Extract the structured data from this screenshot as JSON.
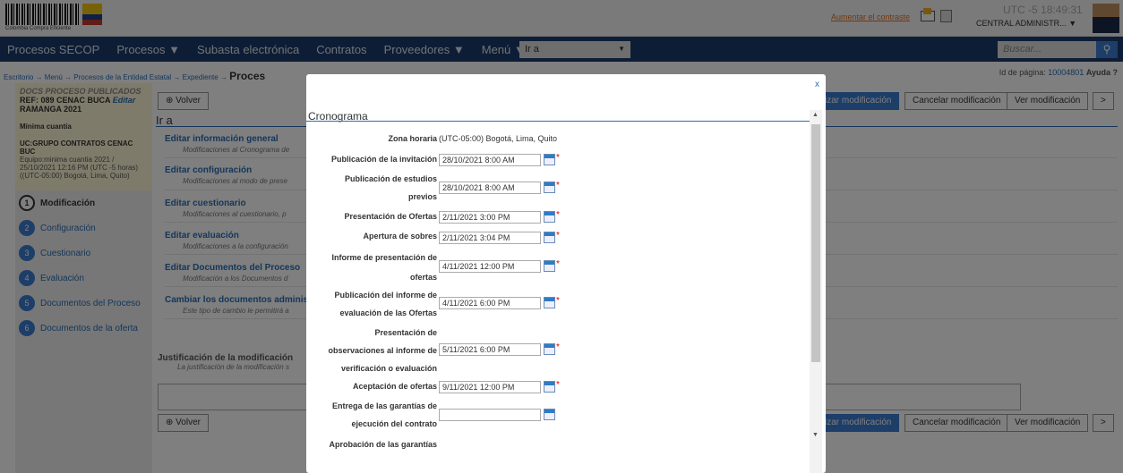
{
  "header": {
    "logo_caption": "Colombia Compra Eficiente",
    "toplink": "Aumentar el contraste",
    "clock_zone": "UTC -5",
    "clock_time": "18:49:31",
    "user": "CENTRAL ADMINISTR..."
  },
  "nav": {
    "items": [
      "Procesos SECOP",
      "Procesos ▼",
      "Subasta electrónica",
      "Contratos",
      "Proveedores ▼",
      "Menú ▼"
    ],
    "ira": "Ir a",
    "search_placeholder": "Buscar..."
  },
  "breadcrumb": {
    "path": "Escritorio → Menú → Procesos de la Entidad Estatal → Expediente →",
    "current": "Proces",
    "page_id_label": "Id de página:",
    "page_id": "10004801",
    "help": "Ayuda"
  },
  "sidebar": {
    "docs": "DOCS PROCESO PUBLICADOS",
    "ref": "REF: 089 CENAC BUCA",
    "edit": "Editar",
    "ref2": "RAMANGA 2021",
    "type": "Mínima cuantía",
    "uc": "UC:GRUPO CONTRATOS CENAC BUC",
    "team": "Equipo:minima cuantia 2021 / 25/10/2021 12:16 PM (UTC -5 horas)((UTC-05:00) Bogotá, Lima, Quito)",
    "steps": [
      {
        "n": "1",
        "label": "Modificación"
      },
      {
        "n": "2",
        "label": "Configuración"
      },
      {
        "n": "3",
        "label": "Cuestionario"
      },
      {
        "n": "4",
        "label": "Evaluación"
      },
      {
        "n": "5",
        "label": "Documentos del Proceso"
      },
      {
        "n": "6",
        "label": "Documentos de la oferta"
      }
    ]
  },
  "main": {
    "back": "Volver",
    "ira": "Ir a",
    "apply": "izar modificación",
    "cancel": "Cancelar modificación",
    "view": "Ver modificación",
    "more": ">",
    "edits": [
      {
        "title": "Editar información general",
        "desc": "Modificaciones al Cronograma de"
      },
      {
        "title": "Editar configuración",
        "desc": "Modificaciones al modo de prese"
      },
      {
        "title": "Editar cuestionario",
        "desc": "Modificaciones al cuestionario, p"
      },
      {
        "title": "Editar evaluación",
        "desc": "Modificaciones a la configuración"
      },
      {
        "title": "Editar Documentos del Proceso",
        "desc": "Modificación a los Documentos d"
      },
      {
        "title": "Cambiar los documentos adminis",
        "desc": "Este tipo de cambio le permitirá a"
      }
    ],
    "just_title": "Justificación de la modificación",
    "just_desc": "La justificación de la modificación s"
  },
  "modal": {
    "close": "x",
    "title": "Cronograma",
    "tz_label": "Zona horaria",
    "tz": "(UTC-05:00) Bogotá, Lima, Quito",
    "rows": [
      {
        "l1": "Publicación de la invitación",
        "l2": "",
        "v": "28/10/2021 8:00 AM",
        "req": "*"
      },
      {
        "l1": "Publicación de estudios",
        "l2": "previos",
        "v": "28/10/2021 8:00 AM",
        "req": "*"
      },
      {
        "l1": "Presentación de Ofertas",
        "l2": "",
        "v": "2/11/2021 3:00 PM",
        "req": "*"
      },
      {
        "l1": "Apertura de sobres",
        "l2": "",
        "v": "2/11/2021 3:04 PM",
        "req": "*"
      },
      {
        "l1": "Informe de presentación de",
        "l2": "ofertas",
        "v": "4/11/2021 12:00 PM",
        "req": "*"
      },
      {
        "l1": "Publicación del informe de",
        "l2": "evaluación de las Ofertas",
        "v": "4/11/2021 6:00 PM",
        "req": "*"
      },
      {
        "l1": "Presentación de",
        "l1b": "observaciones al informe de",
        "l2": "verificación o evaluación",
        "v": "5/11/2021 6:00 PM",
        "req": "*"
      },
      {
        "l1": "Aceptación de ofertas",
        "l2": "",
        "v": "9/11/2021 12:00 PM",
        "req": "*"
      },
      {
        "l1": "Entrega de las garantías de",
        "l2": "ejecución del contrato",
        "v": "",
        "req": ""
      },
      {
        "l1": "Aprobación de las garantías",
        "l2": "",
        "v": "",
        "req": ""
      }
    ]
  }
}
